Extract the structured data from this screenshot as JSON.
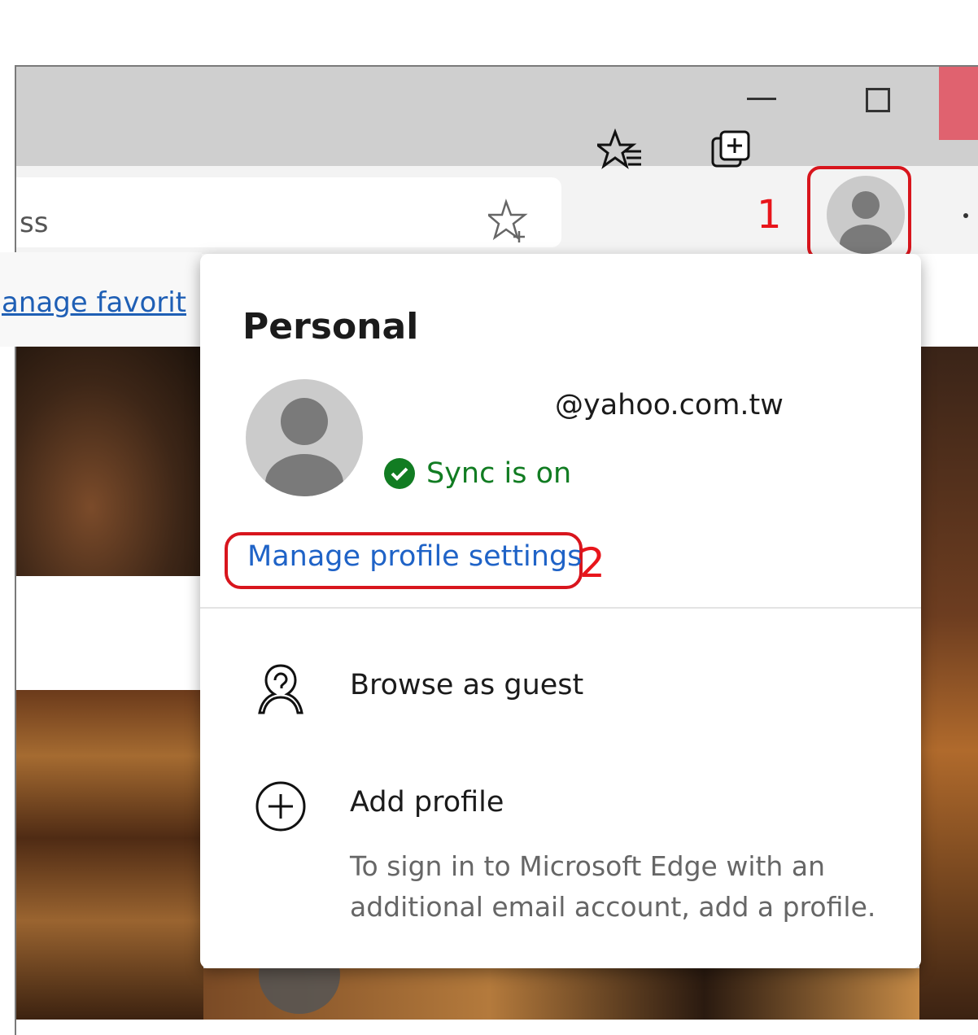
{
  "toolbar": {
    "address_text": "ss",
    "favorites_link": "anage favorit"
  },
  "annotations": {
    "step1": "1",
    "step2": "2",
    "color": "#e8151b"
  },
  "profile_flyout": {
    "title": "Personal",
    "email": "@yahoo.com.tw",
    "sync_status": "Sync is on",
    "manage_link": "Manage profile settings",
    "browse_guest": "Browse as guest",
    "add_profile": "Add profile",
    "add_profile_desc": "To sign in to Microsoft Edge with an additional email account, add a profile."
  },
  "icons": {
    "add_favorite": "star-plus-icon",
    "favorites": "favorites-list-icon",
    "collections": "collections-icon",
    "profile": "person-icon",
    "guest": "guest-person-icon",
    "add": "circle-plus-icon",
    "sync": "check-circle-icon"
  },
  "colors": {
    "sync_green": "#117c22",
    "link_blue": "#1f63c7",
    "close_red": "#e0626f"
  }
}
